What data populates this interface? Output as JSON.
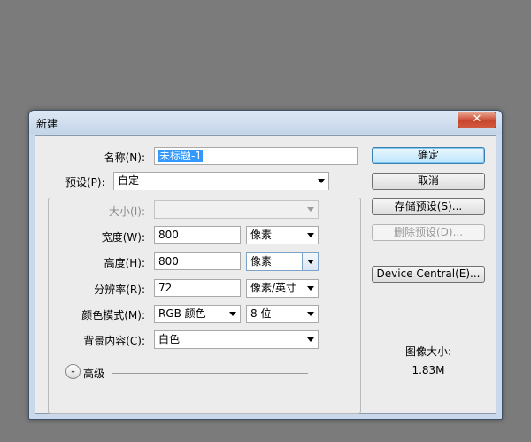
{
  "window": {
    "title": "新建",
    "close_glyph": "✕"
  },
  "form": {
    "name": {
      "label": "名称(N):",
      "value": "未标题-1"
    },
    "preset": {
      "label": "预设(P):",
      "value": "自定"
    },
    "size": {
      "label": "大小(I):",
      "value": ""
    },
    "width": {
      "label": "宽度(W):",
      "value": "800",
      "unit": "像素"
    },
    "height": {
      "label": "高度(H):",
      "value": "800",
      "unit": "像素"
    },
    "resolution": {
      "label": "分辨率(R):",
      "value": "72",
      "unit": "像素/英寸"
    },
    "color_mode": {
      "label": "颜色模式(M):",
      "value": "RGB 颜色",
      "depth": "8 位"
    },
    "background": {
      "label": "背景内容(C):",
      "value": "白色"
    },
    "advanced": {
      "label": "高级"
    }
  },
  "buttons": {
    "ok": "确定",
    "cancel": "取消",
    "save_preset": "存储预设(S)...",
    "delete_preset": "删除预设(D)...",
    "device_central": "Device Central(E)..."
  },
  "image_info": {
    "label": "图像大小:",
    "value": "1.83M"
  }
}
